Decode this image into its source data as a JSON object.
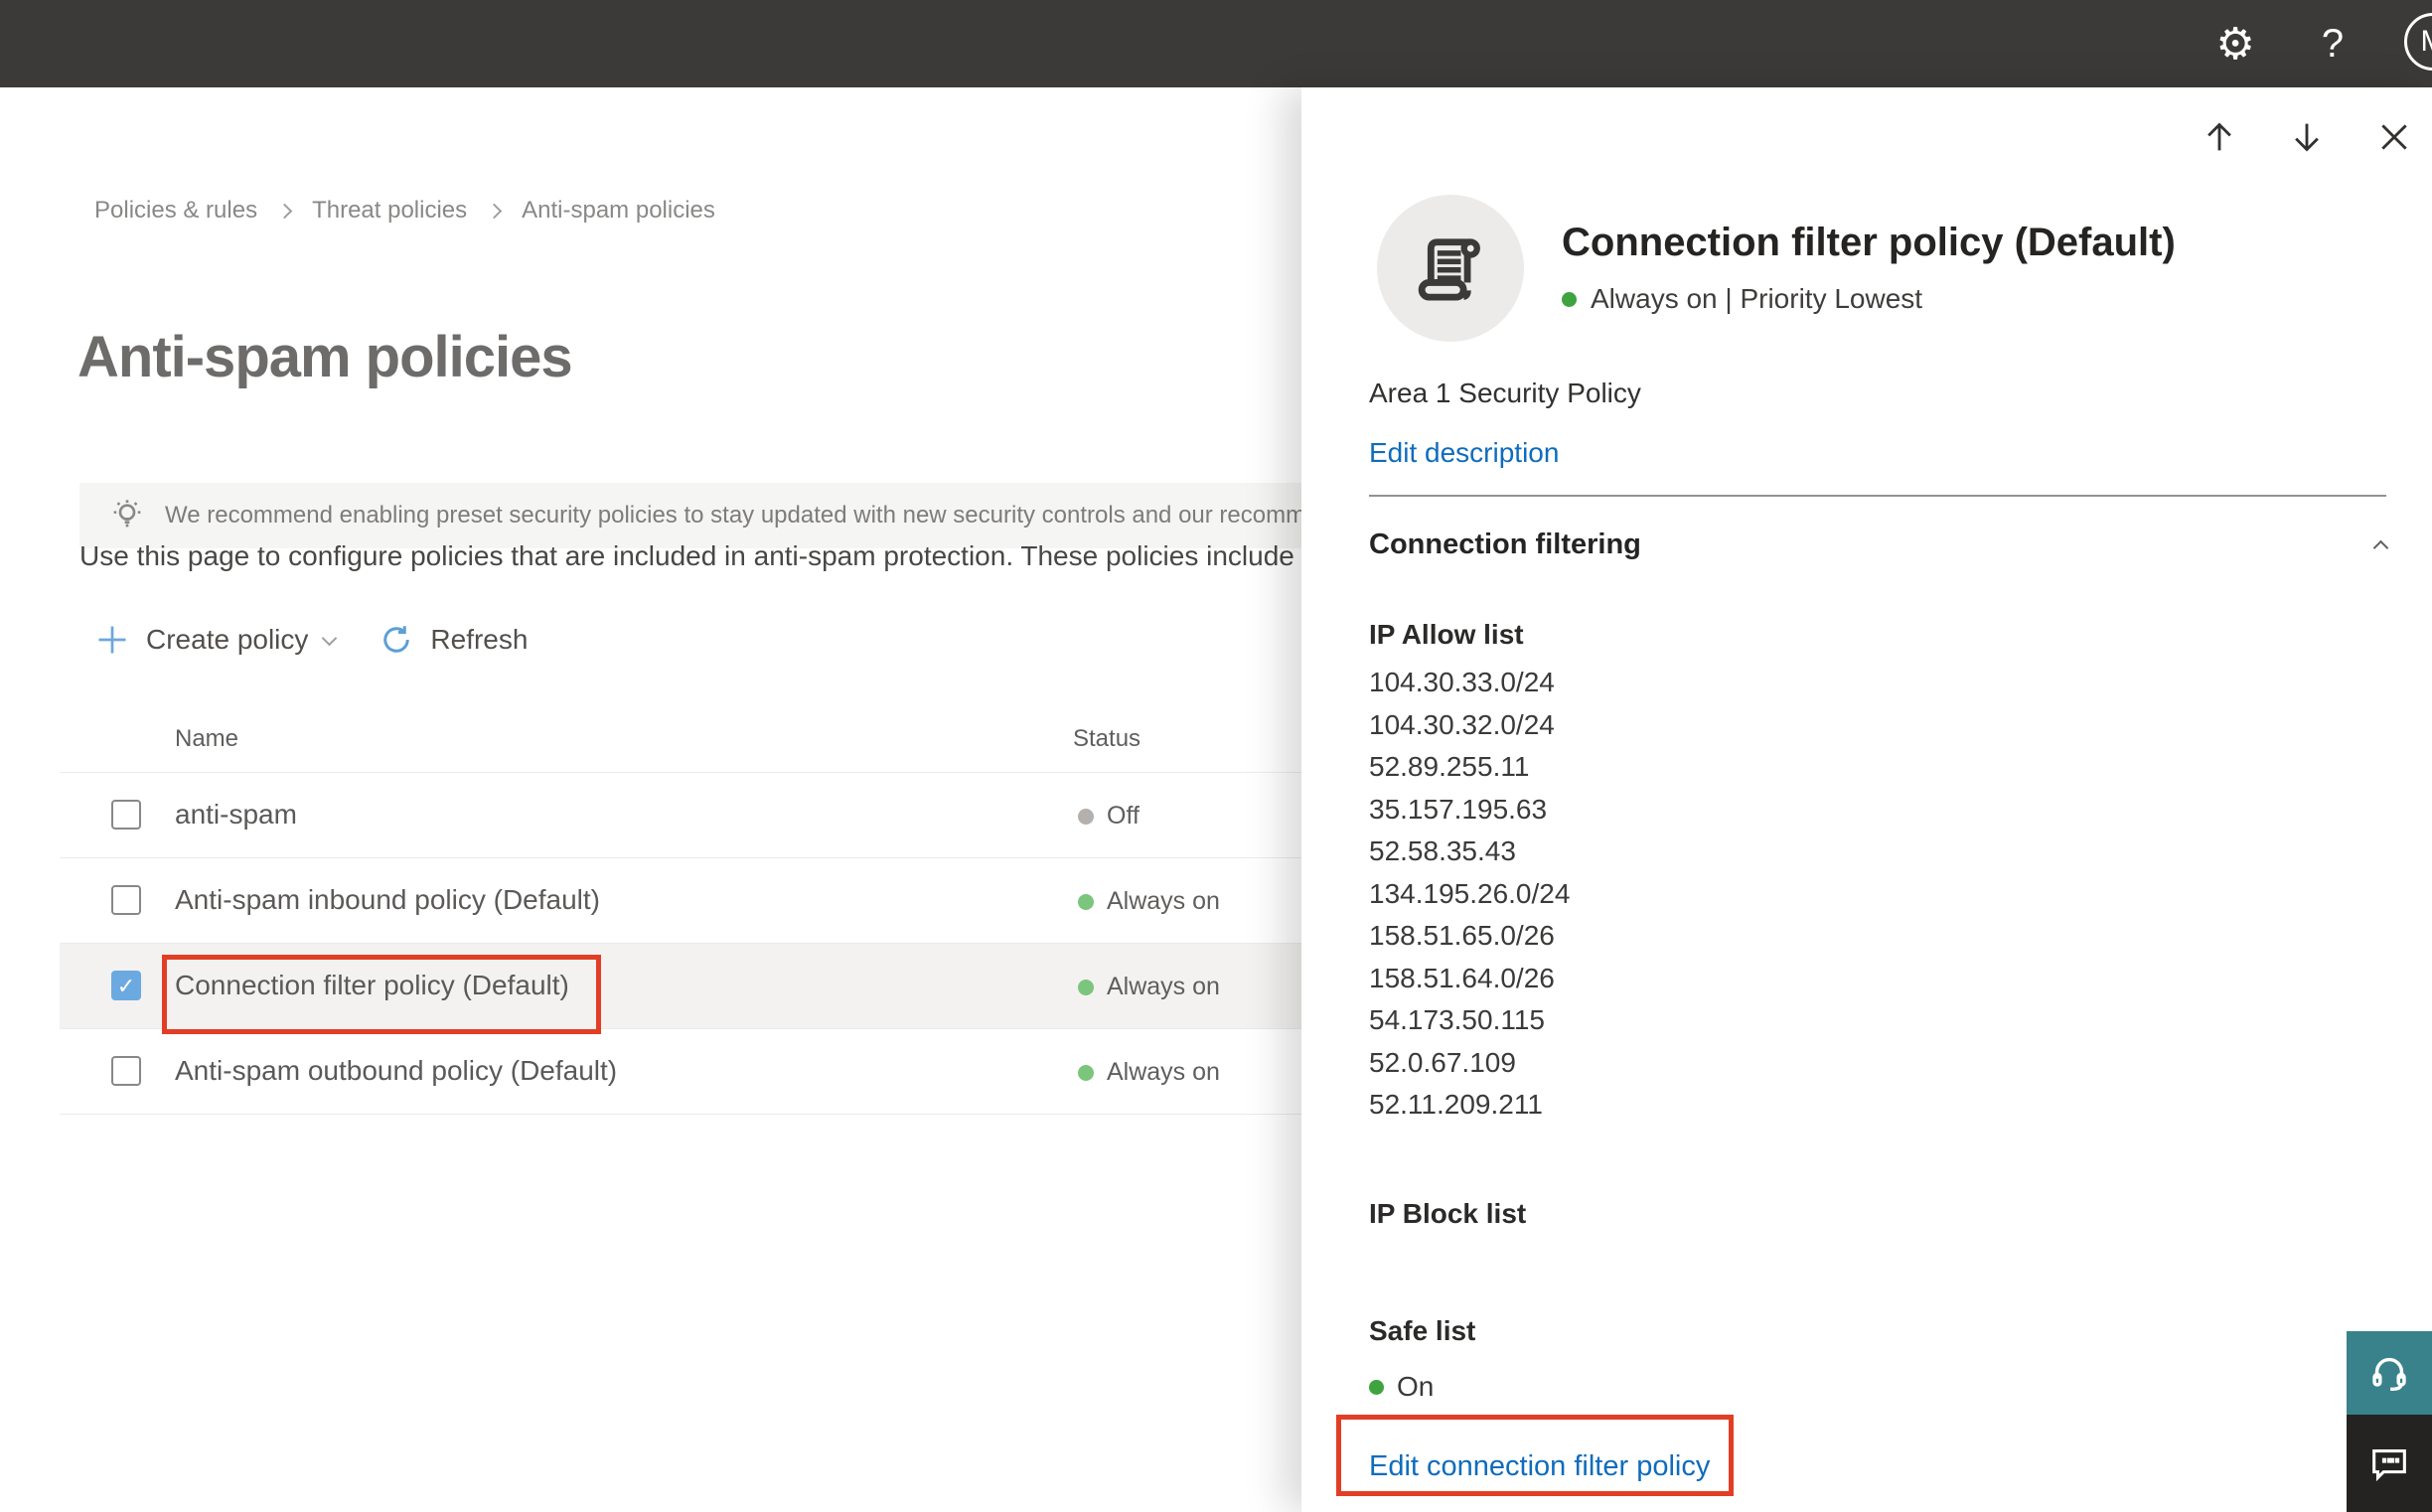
{
  "topbar": {
    "help_label": "?",
    "avatar_initial": "M"
  },
  "breadcrumb": {
    "item1": "Policies & rules",
    "item2": "Threat policies",
    "item3": "Anti-spam policies"
  },
  "page": {
    "title": "Anti-spam policies",
    "banner_text": "We recommend enabling preset security policies to stay updated with new security controls and our recomme",
    "description": "Use this page to configure policies that are included in anti-spam protection. These policies include",
    "toolbar": {
      "create_policy_label": "Create policy",
      "refresh_label": "Refresh"
    }
  },
  "table": {
    "columns": {
      "name": "Name",
      "status": "Status"
    },
    "rows": [
      {
        "name": "anti-spam",
        "status": "Off",
        "status_color": "gray",
        "checked": false,
        "selected": false
      },
      {
        "name": "Anti-spam inbound policy (Default)",
        "status": "Always on",
        "status_color": "green",
        "checked": false,
        "selected": false
      },
      {
        "name": "Connection filter policy (Default)",
        "status": "Always on",
        "status_color": "green",
        "checked": true,
        "selected": true,
        "annotated": true
      },
      {
        "name": "Anti-spam outbound policy (Default)",
        "status": "Always on",
        "status_color": "green",
        "checked": false,
        "selected": false
      }
    ]
  },
  "panel": {
    "title": "Connection filter policy (Default)",
    "status_line": "Always on | Priority Lowest",
    "description": "Area 1 Security Policy",
    "edit_description_label": "Edit description",
    "section_title": "Connection filtering",
    "ip_allow_title": "IP Allow list",
    "ip_allow_list": [
      "104.30.33.0/24",
      "104.30.32.0/24",
      "52.89.255.11",
      "35.157.195.63",
      "52.58.35.43",
      "134.195.26.0/24",
      "158.51.65.0/26",
      "158.51.64.0/26",
      "54.173.50.115",
      "52.0.67.109",
      "52.11.209.211"
    ],
    "ip_block_title": "IP Block list",
    "safe_list_title": "Safe list",
    "safe_list_status": "On",
    "edit_policy_label": "Edit connection filter policy"
  },
  "colors": {
    "topbar_bg": "#3B3A39",
    "link_blue": "#0F6CBD",
    "status_green": "#7CC57C",
    "status_gray": "#B3B0AD",
    "annotation_red": "#E23E26",
    "selected_row_bg": "#F3F2F1",
    "headset_button_teal": "#3A828B",
    "chat_button_dark": "#252321"
  }
}
